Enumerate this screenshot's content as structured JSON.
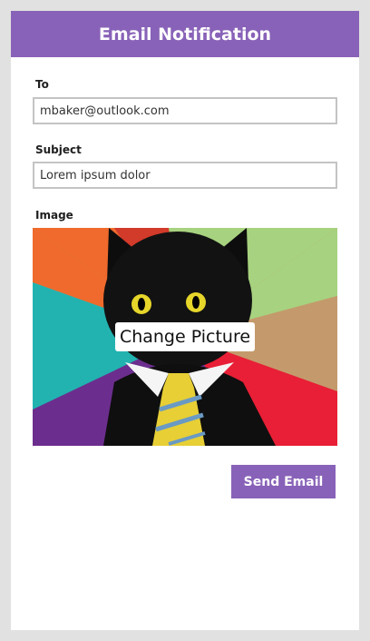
{
  "header": {
    "title": "Email Notification"
  },
  "form": {
    "to_label": "To",
    "to_value": "mbaker@outlook.com",
    "subject_label": "Subject",
    "subject_value": "Lorem ipsum dolor",
    "image_label": "Image",
    "change_picture_label": "Change Picture",
    "send_label": "Send Email"
  },
  "colors": {
    "accent": "#8862b8",
    "page_background": "#e1e1e1",
    "field_border": "#c4c4c4"
  }
}
